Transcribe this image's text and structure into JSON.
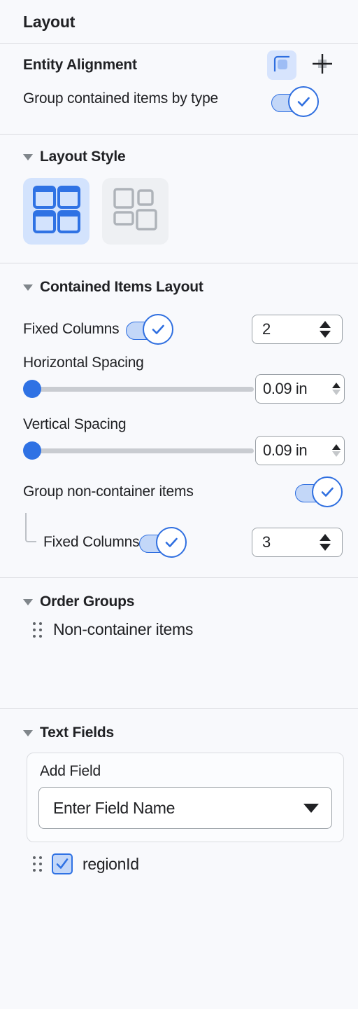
{
  "panel": {
    "title": "Layout"
  },
  "entity_alignment": {
    "label": "Entity Alignment",
    "options": [
      {
        "icon": "container-align-icon",
        "selected": true
      },
      {
        "icon": "crosshair-align-icon",
        "selected": false
      }
    ],
    "group_by_type": {
      "label": "Group contained items by type",
      "enabled": true
    }
  },
  "layout_style": {
    "title": "Layout Style",
    "options": [
      {
        "icon": "grid-layout-icon",
        "selected": true
      },
      {
        "icon": "free-layout-icon",
        "selected": false
      }
    ]
  },
  "contained_items": {
    "title": "Contained Items Layout",
    "fixed_columns": {
      "label": "Fixed Columns",
      "enabled": true,
      "value": "2"
    },
    "horizontal_spacing": {
      "label": "Horizontal Spacing",
      "value": "0.09 in",
      "slider_percent": 0
    },
    "vertical_spacing": {
      "label": "Vertical Spacing",
      "value": "0.09 in",
      "slider_percent": 0
    },
    "group_non_container": {
      "label": "Group non-container items",
      "enabled": true
    },
    "nested_fixed_columns": {
      "label": "Fixed Columns",
      "enabled": true,
      "value": "3"
    }
  },
  "order_groups": {
    "title": "Order Groups",
    "items": [
      {
        "label": "Non-container items",
        "handle": "drag-handle-icon"
      }
    ]
  },
  "text_fields": {
    "title": "Text Fields",
    "add_field": {
      "label": "Add Field",
      "placeholder": "Enter Field Name",
      "value": "Enter Field Name"
    },
    "fields": [
      {
        "label": "regionId",
        "checked": true
      }
    ]
  },
  "colors": {
    "accent": "#2f72e4",
    "accent_light": "#c3d7f8",
    "selected_bg": "#d3e3fd",
    "panel_bg": "#f8f9fc",
    "divider": "#dadce0",
    "text": "#202124",
    "muted": "#80868b"
  }
}
